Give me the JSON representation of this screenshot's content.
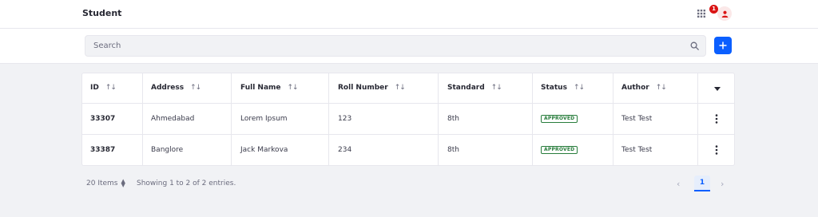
{
  "header": {
    "title": "Student",
    "notification_count": "1"
  },
  "search": {
    "placeholder": "Search"
  },
  "table": {
    "columns": [
      "ID",
      "Address",
      "Full Name",
      "Roll Number",
      "Standard",
      "Status",
      "Author"
    ],
    "sort_glyph": "↑↓",
    "rows": [
      {
        "id": "33307",
        "address": "Ahmedabad",
        "full_name": "Lorem Ipsum",
        "roll_number": "123",
        "standard": "8th",
        "status": "APPROVED",
        "author": "Test Test"
      },
      {
        "id": "33387",
        "address": "Banglore",
        "full_name": "Jack Markova",
        "roll_number": "234",
        "standard": "8th",
        "status": "APPROVED",
        "author": "Test Test"
      }
    ]
  },
  "footer": {
    "items_per_page": "20 Items",
    "showing": "Showing 1 to 2 of 2 entries.",
    "current_page": "1"
  },
  "colors": {
    "accent": "#0b5fff",
    "approved": "#287d3c",
    "badge": "#da1414"
  },
  "icons": {
    "apps": "grid-icon",
    "user": "user-icon",
    "search": "search-icon",
    "add": "plus-icon",
    "row_actions": "kebab-icon",
    "columns_menu": "caret-down-icon"
  }
}
